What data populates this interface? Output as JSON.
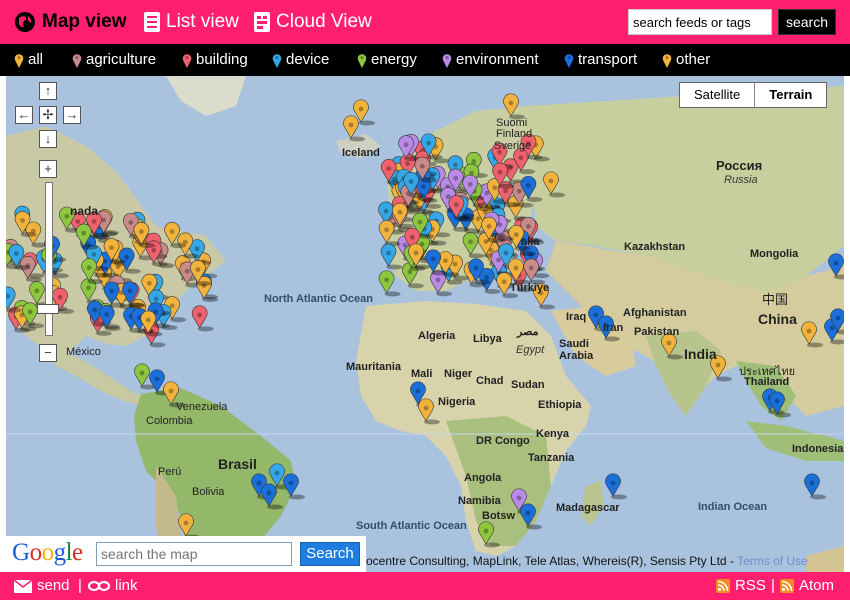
{
  "header": {
    "tabs": [
      {
        "label": "Map view",
        "icon": "globe-icon",
        "active": true
      },
      {
        "label": "List view",
        "icon": "list-icon",
        "active": false
      },
      {
        "label": "Cloud View",
        "icon": "cloud-icon",
        "active": false
      }
    ],
    "search_placeholder": "search feeds or tags",
    "search_button": "search"
  },
  "categories": [
    {
      "label": "all",
      "color": "#f2b33d"
    },
    {
      "label": "agriculture",
      "color": "#c98a8a"
    },
    {
      "label": "building",
      "color": "#f0616e"
    },
    {
      "label": "device",
      "color": "#35a7e6"
    },
    {
      "label": "energy",
      "color": "#8dc63f"
    },
    {
      "label": "environment",
      "color": "#b98ae6"
    },
    {
      "label": "transport",
      "color": "#1a6fd9"
    },
    {
      "label": "other",
      "color": "#f2b33d"
    }
  ],
  "map": {
    "map_type_buttons": [
      {
        "label": "Satellite",
        "active": false
      },
      {
        "label": "Terrain",
        "active": true
      }
    ],
    "labels": {
      "canada": "nada",
      "mexico": "México",
      "venezuela": "Venezuela",
      "colombia": "Colombia",
      "peru": "Perú",
      "brasil": "Brasil",
      "bolivia": "Bolivia",
      "north_atlantic": "North Atlantic Ocean",
      "south_atlantic": "South Atlantic Ocean",
      "iceland": "Iceland",
      "suomi": "Suomi Finland",
      "sverige": "Sverige",
      "rossiya": "Россия",
      "russia": "Russia",
      "kazakhstan": "Kazakhstan",
      "mongolia": "Mongolia",
      "china_zh": "中国",
      "china": "China",
      "algeria": "Algeria",
      "libya": "Libya",
      "egypt_ar": "مصر",
      "egypt": "Egypt",
      "mauritania": "Mauritania",
      "mali": "Mali",
      "niger": "Niger",
      "chad": "Chad",
      "sudan": "Sudan",
      "nigeria": "Nigeria",
      "ethiopia": "Ethiopia",
      "kenya": "Kenya",
      "dr_congo": "DR Congo",
      "tanzania": "Tanzania",
      "angola": "Angola",
      "namibia": "Namibia",
      "botswana": "Botsw",
      "madagascar": "Madagascar",
      "indian_ocean": "Indian Ocean",
      "iraq": "Iraq",
      "iran": "Iran",
      "afghanistan": "Afghanistan",
      "pakistan": "Pakistan",
      "saudi": "Saudi Arabia",
      "india": "India",
      "thailand_th": "ประเทศไทย",
      "thailand": "Thailand",
      "indonesia": "Indonesia",
      "turkiye": "Türkiye",
      "alia": "alia"
    },
    "google_search_placeholder": "search the map",
    "google_search_button": "Search",
    "google_logo": "Google",
    "attribution": "ocentre Consulting, MapLink, Tele Atlas, Whereis(R), Sensis Pty Ltd - ",
    "terms_link": "Terms of Use"
  },
  "footer": {
    "send": "send",
    "link": "link",
    "rss": "RSS",
    "atom": "Atom",
    "separator": "|"
  }
}
